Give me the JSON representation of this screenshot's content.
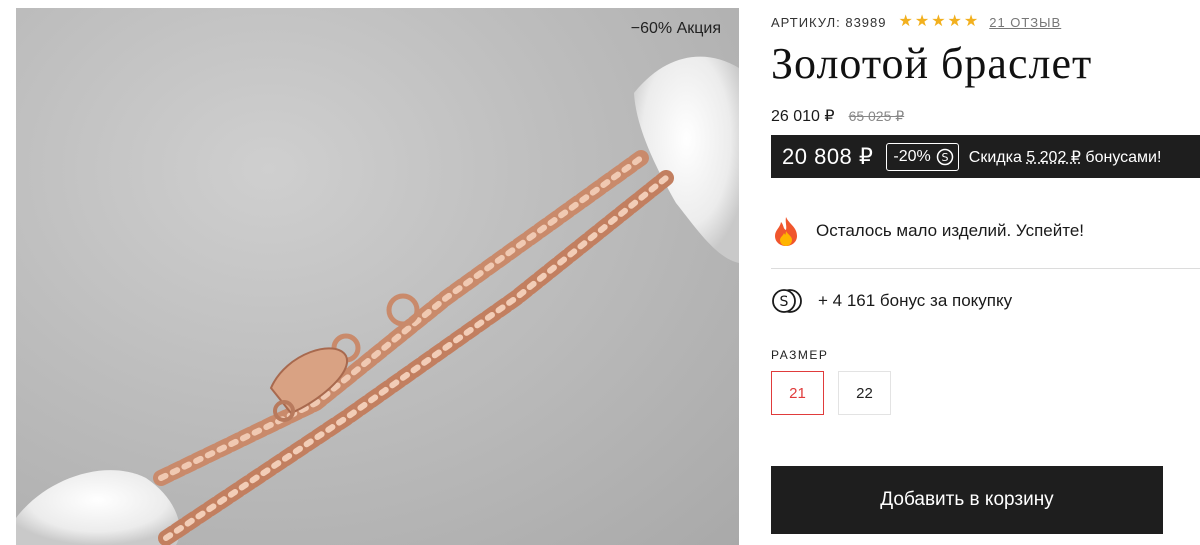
{
  "product": {
    "promo_label": "−60% Акция",
    "sku": "АРТИКУЛ: 83989",
    "rating": 5,
    "reviews_label": "21 ОТЗЫВ",
    "title": "Золотой браслет",
    "price": "26 010 ₽",
    "old_price": "65 025 ₽",
    "final_price": "20 808 ₽",
    "discount": "-20%",
    "bonus_prefix": "Скидка",
    "bonus_amount": "5 202 ₽",
    "bonus_suffix": "бонусами!",
    "stock_note": "Осталось мало изделий. Успейте!",
    "purchase_bonus": "+ 4 161 бонус за покупку",
    "size_label": "РАЗМЕР",
    "sizes": [
      "21",
      "22"
    ],
    "selected_size": "21",
    "add_to_cart": "Добавить в корзину"
  },
  "colors": {
    "accent_red": "#e03b3b",
    "dark_bar": "#1e1e1e",
    "star": "#f2b01e"
  },
  "icons": {
    "rating": "star-icon",
    "stock": "fire-icon",
    "bonus": "coins-icon"
  }
}
